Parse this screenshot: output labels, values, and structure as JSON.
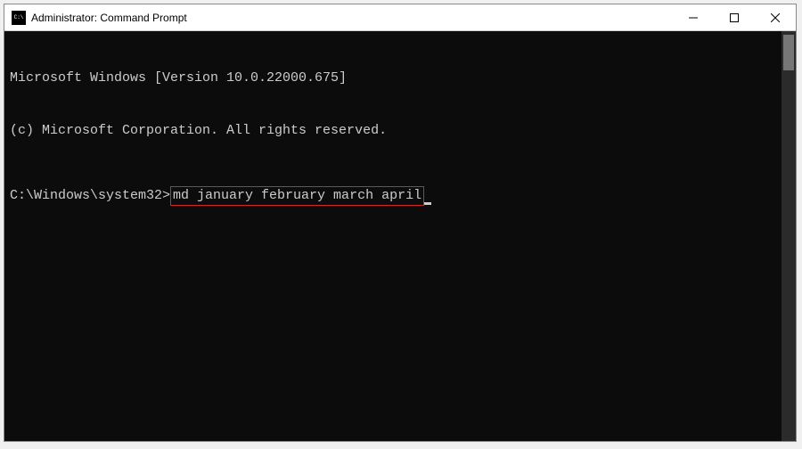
{
  "titlebar": {
    "title": "Administrator: Command Prompt"
  },
  "terminal": {
    "line1": "Microsoft Windows [Version 10.0.22000.675]",
    "line2": "(c) Microsoft Corporation. All rights reserved.",
    "prompt": "C:\\Windows\\system32>",
    "command": "md january february march april"
  },
  "annotations": {
    "highlight_color": "#cc2a2a"
  }
}
